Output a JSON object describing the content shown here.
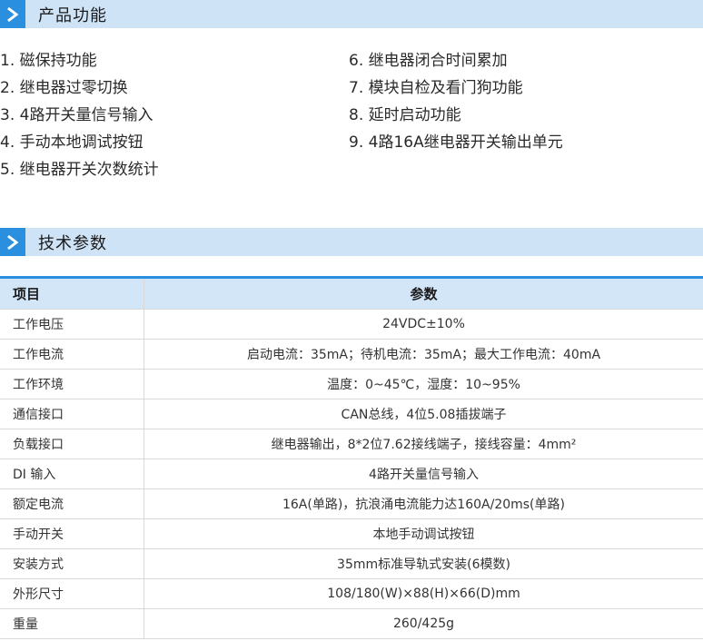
{
  "sections": {
    "features_title": "产品功能",
    "params_title": "技术参数"
  },
  "features": {
    "left": [
      "1. 磁保持功能",
      "2. 继电器过零切换",
      "3. 4路开关量信号输入",
      "4. 手动本地调试按钮",
      "5. 继电器开关次数统计"
    ],
    "right": [
      "6. 继电器闭合时间累加",
      "7. 模块自检及看门狗功能",
      "8. 延时启动功能",
      "9. 4路16A继电器开关输出单元"
    ]
  },
  "table": {
    "headers": [
      "项目",
      "参数"
    ],
    "rows": [
      [
        "工作电压",
        "24VDC±10%"
      ],
      [
        "工作电流",
        "启动电流：35mA；待机电流：35mA；最大工作电流：40mA"
      ],
      [
        "工作环境",
        "温度：0~45℃，湿度：10~95%"
      ],
      [
        "通信接口",
        "CAN总线，4位5.08插拔端子"
      ],
      [
        "负载接口",
        "继电器输出，8*2位7.62接线端子，接线容量：4mm²"
      ],
      [
        "DI 输入",
        "4路开关量信号输入"
      ],
      [
        "额定电流",
        "16A(单路)，抗浪涌电流能力达160A/20ms(单路)"
      ],
      [
        "手动开关",
        "本地手动调试按钮"
      ],
      [
        "安装方式",
        "35mm标准导轨式安装(6模数)"
      ],
      [
        "外形尺寸",
        "108/180(W)×88(H)×66(D)mm"
      ],
      [
        "重量",
        "260/425g"
      ]
    ]
  },
  "colors": {
    "accent": "#2b8fe0",
    "header_bg": "#cfe3f6",
    "table_header_bg": "#d3e6f8"
  },
  "icons": {
    "section_marker": "chevron-right-icon"
  }
}
